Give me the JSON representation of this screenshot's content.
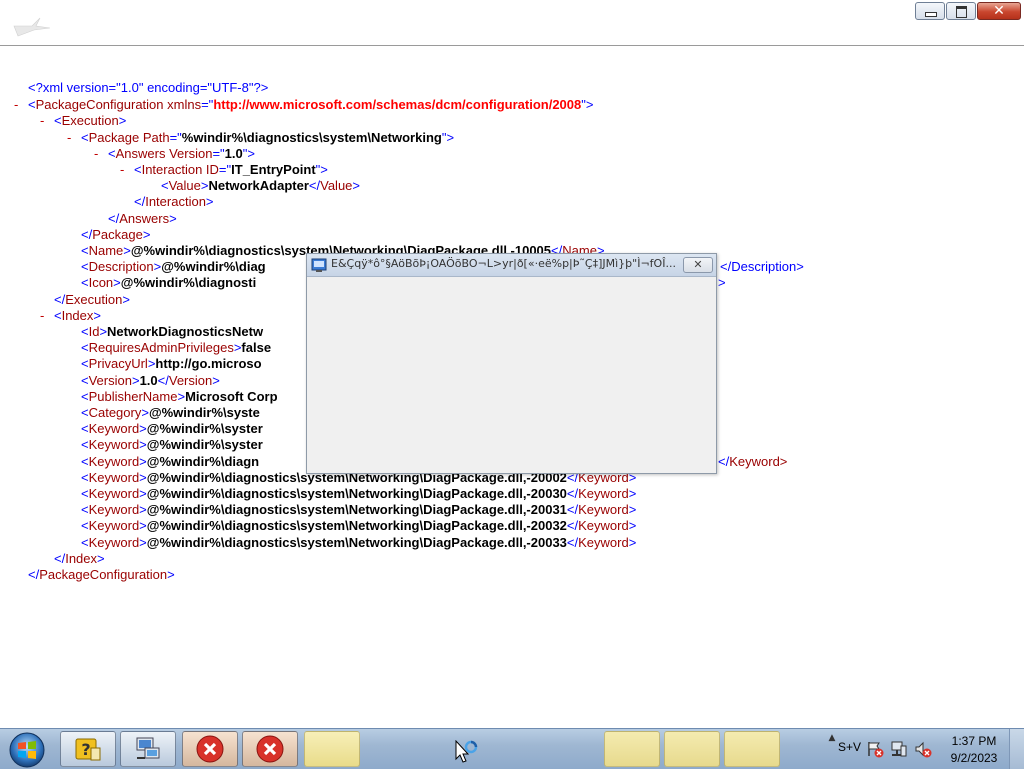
{
  "window": {
    "controls": {
      "minimize": "minimize",
      "maximize": "restore",
      "close": "close"
    }
  },
  "xml": {
    "l1": {
      "text": "<?xml version=\"1.0\" encoding=\"UTF-8\"?>"
    },
    "l2": {
      "tag": "PackageConfiguration",
      "attr": "xmlns",
      "val": "http://www.microsoft.com/schemas/dcm/configuration/2008"
    },
    "l3": {
      "tag": "Execution"
    },
    "l4": {
      "tag": "Package",
      "attr": "Path",
      "val": "%windir%\\diagnostics\\system\\Networking"
    },
    "l5": {
      "tag": "Answers",
      "attr": "Version",
      "val": "1.0"
    },
    "l6": {
      "tag": "Interaction",
      "attr": "ID",
      "val": "IT_EntryPoint"
    },
    "l7": {
      "tag": "Value",
      "val": "NetworkAdapter"
    },
    "l8": {
      "tag": "Interaction"
    },
    "l9": {
      "tag": "Answers"
    },
    "l10": {
      "tag": "Package"
    },
    "l11": {
      "tag": "Name",
      "val": "@%windir%\\diagnostics\\system\\Networking\\DiagPackage.dll,-10005"
    },
    "l12": {
      "tag": "Description",
      "val": "@%windir%\\diag"
    },
    "l13": {
      "tag": "Icon",
      "val": "@%windir%\\diagnosti"
    },
    "l14": {
      "tag": "Execution"
    },
    "l15": {
      "tag": "Index"
    },
    "l16": {
      "tag": "Id",
      "val": "NetworkDiagnosticsNetw"
    },
    "l17": {
      "tag": "RequiresAdminPrivileges",
      "val": "false"
    },
    "l18": {
      "tag": "PrivacyUrl",
      "val": "http://go.microso"
    },
    "l19": {
      "tag": "Version",
      "val": "1.0"
    },
    "l20": {
      "tag": "PublisherName",
      "val": "Microsoft Corp"
    },
    "l21": {
      "tag": "Category",
      "val": "@%windir%\\syste"
    },
    "l22": {
      "tag": "Keyword",
      "val": "@%windir%\\syster"
    },
    "l23": {
      "tag": "Keyword",
      "val": "@%windir%\\syster"
    },
    "l24": {
      "tag": "Keyword",
      "val": "@%windir%\\diagn"
    },
    "l25": {
      "tag": "Keyword",
      "val": "@%windir%\\diagnostics\\system\\Networking\\DiagPackage.dll,-20002"
    },
    "l26": {
      "tag": "Keyword",
      "val": "@%windir%\\diagnostics\\system\\Networking\\DiagPackage.dll,-20030"
    },
    "l27": {
      "tag": "Keyword",
      "val": "@%windir%\\diagnostics\\system\\Networking\\DiagPackage.dll,-20031"
    },
    "l28": {
      "tag": "Keyword",
      "val": "@%windir%\\diagnostics\\system\\Networking\\DiagPackage.dll,-20032"
    },
    "l29": {
      "tag": "Keyword",
      "val": "@%windir%\\diagnostics\\system\\Networking\\DiagPackage.dll,-20033"
    },
    "l30": {
      "tag": "Index"
    },
    "l31": {
      "tag": "PackageConfiguration"
    },
    "tail_description": "</Description",
    "tail_icon": ">",
    "tail_keyword": "Keyword>"
  },
  "dialog": {
    "title": "E&Çqÿ*ô°§AöBõÞ¡OAÖõBO¬L>yr|ð[«·eë%p|Þ˜Ç‡]JMì}þ\"Ì¬fOÎ...",
    "close_label": "✕",
    "icon": "app-icon"
  },
  "taskbar": {
    "items": [
      {
        "name": "help-icon"
      },
      {
        "name": "network-setup-icon"
      },
      {
        "name": "error-icon"
      },
      {
        "name": "error-icon"
      }
    ],
    "tray_expand": "▲",
    "tray_lang": "S+V",
    "clock_time": "1:37 PM",
    "clock_date": "9/2/2023"
  }
}
